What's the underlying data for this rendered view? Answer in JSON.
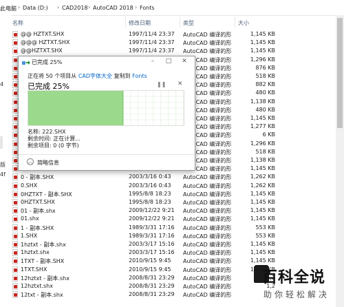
{
  "breadcrumb": {
    "root": "此电脑",
    "items": [
      "Data (D:)",
      "CAD2018",
      "AutoCAD 2018",
      "Fonts"
    ],
    "separator": "›"
  },
  "left_pane": {
    "labels": [
      "4",
      "版",
      "4f"
    ]
  },
  "columns": {
    "name": "名称",
    "date": "修改日期",
    "type": "类型",
    "size": "大小"
  },
  "files": [
    {
      "name": "@@ HZTXT.SHX",
      "date": "1997/11/4 23:37",
      "type": "AutoCAD 编译的形",
      "size": "1,145 KB"
    },
    {
      "name": "@@@ HZTXT.SHX",
      "date": "1997/11/4 23:37",
      "type": "AutoCAD 编译的形",
      "size": "1,145 KB"
    },
    {
      "name": "@@HZTXT.SHX",
      "date": "1997/11/4 23:37",
      "type": "AutoCAD 编译的形",
      "size": "1,145 KB"
    },
    {
      "name": "",
      "date": "",
      "type": "AutoCAD 编译的形",
      "size": "1,296 KB"
    },
    {
      "name": "",
      "date": "",
      "type": "AutoCAD 编译的形",
      "size": "876 KB"
    },
    {
      "name": "",
      "date": "",
      "type": "AutoCAD 编译的形",
      "size": "518 KB"
    },
    {
      "name": "",
      "date": "",
      "type": "AutoCAD 编译的形",
      "size": "882 KB"
    },
    {
      "name": "",
      "date": "",
      "type": "AutoCAD 编译的形",
      "size": "480 KB"
    },
    {
      "name": "",
      "date": "",
      "type": "AutoCAD 编译的形",
      "size": "1,138 KB"
    },
    {
      "name": "",
      "date": "",
      "type": "AutoCAD 编译的形",
      "size": "480 KB"
    },
    {
      "name": "",
      "date": "",
      "type": "AutoCAD 编译的形",
      "size": "1,145 KB"
    },
    {
      "name": "",
      "date": "",
      "type": "AutoCAD 编译的形",
      "size": "1,277 KB"
    },
    {
      "name": "",
      "date": "",
      "type": "AutoCAD 编译的形",
      "size": "6 KB"
    },
    {
      "name": "",
      "date": "",
      "type": "AutoCAD 编译的形",
      "size": "1,296 KB"
    },
    {
      "name": "",
      "date": "",
      "type": "AutoCAD 编译的形",
      "size": "518 KB"
    },
    {
      "name": "",
      "date": "",
      "type": "AutoCAD 编译的形",
      "size": "1,138 KB"
    },
    {
      "name": "",
      "date": "",
      "type": "AutoCAD 编译的形",
      "size": "1,145 KB"
    },
    {
      "name": "0 - 副本.SHX",
      "date": "2003/3/16 0:43",
      "type": "AutoCAD 编译的形",
      "size": "1,262 KB"
    },
    {
      "name": "0.SHX",
      "date": "2003/3/16 0:43",
      "type": "AutoCAD 编译的形",
      "size": "1,262 KB"
    },
    {
      "name": "0HZTXT - 副本.SHX",
      "date": "1995/8/8 18:23",
      "type": "AutoCAD 编译的形",
      "size": "1,145 KB"
    },
    {
      "name": "0HZTXT.SHX",
      "date": "1995/8/8 18:23",
      "type": "AutoCAD 编译的形",
      "size": "1,145 KB"
    },
    {
      "name": "01 - 副本.shx",
      "date": "2009/12/22 9:21",
      "type": "AutoCAD 编译的形",
      "size": "1,145 KB"
    },
    {
      "name": "01.shx",
      "date": "2009/12/22 9:21",
      "type": "AutoCAD 编译的形",
      "size": "1,145 KB"
    },
    {
      "name": "1 - 副本.SHX",
      "date": "1989/3/31 17:16",
      "type": "AutoCAD 编译的形",
      "size": "553 KB"
    },
    {
      "name": "1.SHX",
      "date": "1989/3/31 17:16",
      "type": "AutoCAD 编译的形",
      "size": "553 KB"
    },
    {
      "name": "1hztxt - 副本.shx",
      "date": "2003/3/17 15:16",
      "type": "AutoCAD 编译的形",
      "size": "1,145 KB"
    },
    {
      "name": "1hztxt.shx",
      "date": "2003/3/17 15:16",
      "type": "AutoCAD 编译的形",
      "size": "1,145 KB"
    },
    {
      "name": "1TXT - 副本.SHX",
      "date": "2010/9/15 9:45",
      "type": "AutoCAD 编译的形",
      "size": "1,145 KB"
    },
    {
      "name": "1TXT.SHX",
      "date": "2010/9/15 9:45",
      "type": "AutoCAD 编译的形",
      "size": "1,145 KB"
    },
    {
      "name": "12hztxt - 副本.shx",
      "date": "2008/8/31 23:29",
      "type": "AutoCAD 编译的形",
      "size": "1,2"
    },
    {
      "name": "12hztxt.shx",
      "date": "2008/8/31 23:29",
      "type": "AutoCAD 编译的形",
      "size": "1,2"
    },
    {
      "name": "12txt - 副本.shx",
      "date": "2008/8/31 23:29",
      "type": "AutoCAD 编译的形",
      "size": ""
    }
  ],
  "dialog": {
    "title": "已完成 25%",
    "status_prefix": "正在将 50 个项目从",
    "source": "CAD字体大全",
    "status_middle": "复制到",
    "destination": "Fonts",
    "percent_text": "已完成 25%",
    "progress": 0.61,
    "name_line": "名称: 222.SHX",
    "time_line": "剩余时间: 正在计算...",
    "items_line": "剩余项目: 0 (0 字节)",
    "less_info": "简略信息"
  },
  "watermark": {
    "title": "百科全说",
    "subtitle": "助你轻松解决"
  },
  "colors": {
    "progress_fill": "#9bd98c",
    "link": "#0066cc",
    "pdf_icon": "#c8261e"
  }
}
